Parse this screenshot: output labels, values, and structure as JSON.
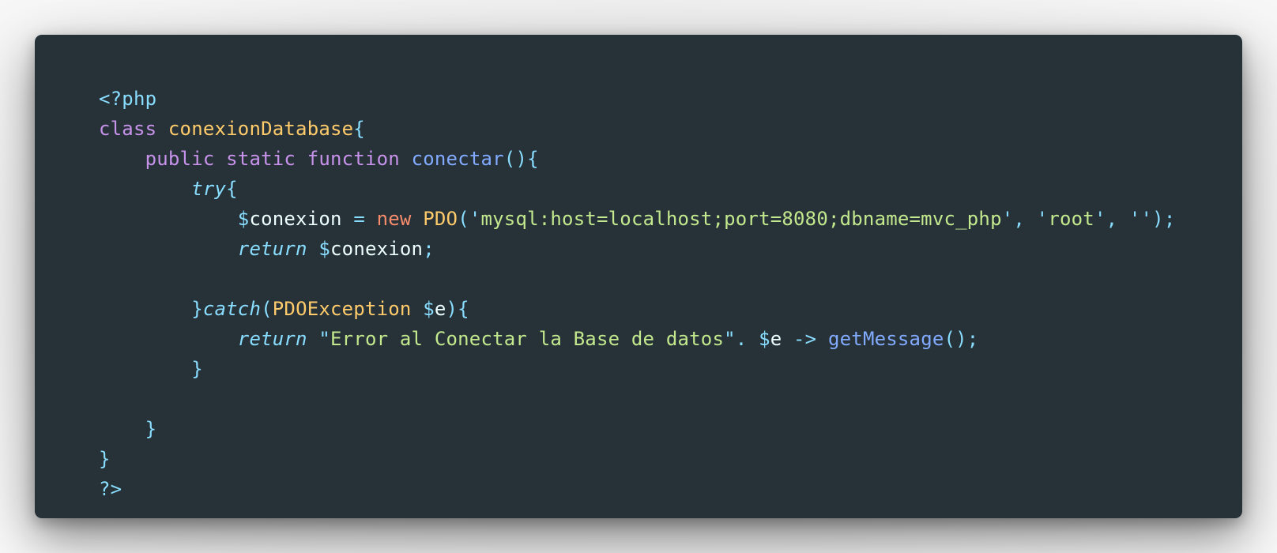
{
  "colors": {
    "background": "#263238",
    "keyword": "#c792ea",
    "class_name": "#ffcb6b",
    "function": "#82aaff",
    "punctuation": "#89ddff",
    "control": "#89ddff",
    "variable": "#eeffff",
    "new_keyword": "#f78c6c",
    "string": "#c3e88d"
  },
  "code": {
    "language": "php",
    "lines": [
      {
        "indent": 0,
        "tokens": [
          {
            "type": "punc",
            "text": "<?php"
          }
        ]
      },
      {
        "indent": 0,
        "tokens": [
          {
            "type": "kw",
            "text": "class"
          },
          {
            "type": "plain",
            "text": " "
          },
          {
            "type": "class",
            "text": "conexionDatabase"
          },
          {
            "type": "punc",
            "text": "{"
          }
        ]
      },
      {
        "indent": 1,
        "tokens": [
          {
            "type": "kw",
            "text": "public"
          },
          {
            "type": "plain",
            "text": " "
          },
          {
            "type": "kw",
            "text": "static"
          },
          {
            "type": "plain",
            "text": " "
          },
          {
            "type": "kw",
            "text": "function"
          },
          {
            "type": "plain",
            "text": " "
          },
          {
            "type": "fn",
            "text": "conectar"
          },
          {
            "type": "punc",
            "text": "(){"
          }
        ]
      },
      {
        "indent": 2,
        "tokens": [
          {
            "type": "ctrl",
            "text": "try"
          },
          {
            "type": "punc",
            "text": "{"
          }
        ]
      },
      {
        "indent": 3,
        "tokens": [
          {
            "type": "punc",
            "text": "$"
          },
          {
            "type": "var",
            "text": "conexion"
          },
          {
            "type": "plain",
            "text": " "
          },
          {
            "type": "punc",
            "text": "="
          },
          {
            "type": "plain",
            "text": " "
          },
          {
            "type": "new",
            "text": "new"
          },
          {
            "type": "plain",
            "text": " "
          },
          {
            "type": "class",
            "text": "PDO"
          },
          {
            "type": "punc",
            "text": "('"
          },
          {
            "type": "str",
            "text": "mysql:host=localhost;port=8080;dbname=mvc_php"
          },
          {
            "type": "punc",
            "text": "', '"
          },
          {
            "type": "str",
            "text": "root"
          },
          {
            "type": "punc",
            "text": "', '');"
          }
        ]
      },
      {
        "indent": 3,
        "tokens": [
          {
            "type": "ctrl",
            "text": "return"
          },
          {
            "type": "plain",
            "text": " "
          },
          {
            "type": "punc",
            "text": "$"
          },
          {
            "type": "var",
            "text": "conexion"
          },
          {
            "type": "punc",
            "text": ";"
          }
        ]
      },
      {
        "indent": 0,
        "tokens": []
      },
      {
        "indent": 2,
        "tokens": [
          {
            "type": "punc",
            "text": "}"
          },
          {
            "type": "ctrl",
            "text": "catch"
          },
          {
            "type": "punc",
            "text": "("
          },
          {
            "type": "class",
            "text": "PDOException"
          },
          {
            "type": "plain",
            "text": " "
          },
          {
            "type": "punc",
            "text": "$"
          },
          {
            "type": "var",
            "text": "e"
          },
          {
            "type": "punc",
            "text": "){"
          }
        ]
      },
      {
        "indent": 3,
        "tokens": [
          {
            "type": "ctrl",
            "text": "return"
          },
          {
            "type": "plain",
            "text": " "
          },
          {
            "type": "punc",
            "text": "\""
          },
          {
            "type": "str",
            "text": "Error al Conectar la Base de datos"
          },
          {
            "type": "punc",
            "text": "\"."
          },
          {
            "type": "plain",
            "text": " "
          },
          {
            "type": "punc",
            "text": "$"
          },
          {
            "type": "var",
            "text": "e"
          },
          {
            "type": "plain",
            "text": " "
          },
          {
            "type": "punc",
            "text": "->"
          },
          {
            "type": "plain",
            "text": " "
          },
          {
            "type": "fn",
            "text": "getMessage"
          },
          {
            "type": "punc",
            "text": "();"
          }
        ]
      },
      {
        "indent": 2,
        "tokens": [
          {
            "type": "punc",
            "text": "}"
          }
        ]
      },
      {
        "indent": 0,
        "tokens": []
      },
      {
        "indent": 1,
        "tokens": [
          {
            "type": "punc",
            "text": "}"
          }
        ]
      },
      {
        "indent": 0,
        "tokens": [
          {
            "type": "punc",
            "text": "}"
          }
        ]
      },
      {
        "indent": 0,
        "tokens": [
          {
            "type": "punc",
            "text": "?>"
          }
        ]
      }
    ]
  }
}
